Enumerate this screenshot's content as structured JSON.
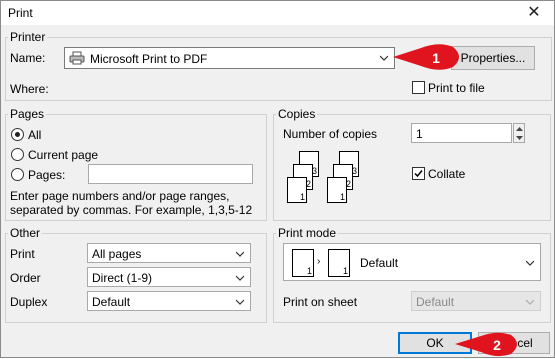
{
  "window": {
    "title": "Print"
  },
  "printer": {
    "group_label": "Printer",
    "name_label": "Name:",
    "name_value": "Microsoft Print to PDF",
    "properties_button": "Properties...",
    "where_label": "Where:",
    "print_to_file_label": "Print to file",
    "print_to_file_checked": false
  },
  "pages": {
    "group_label": "Pages",
    "all_label": "All",
    "current_label": "Current page",
    "pages_label": "Pages:",
    "pages_value": "",
    "selected": "All",
    "hint": [
      "Enter page numbers and/or page ranges,",
      "separated by commas. For example, 1,3,5-12"
    ]
  },
  "copies": {
    "group_label": "Copies",
    "count_label": "Number of copies",
    "count_value": "1",
    "collate_label": "Collate",
    "collate_checked": true,
    "stack_numbers": [
      "3",
      "2",
      "1",
      "3",
      "2",
      "1"
    ]
  },
  "other": {
    "group_label": "Other",
    "print_label": "Print",
    "print_value": "All pages",
    "order_label": "Order",
    "order_value": "Direct (1-9)",
    "duplex_label": "Duplex",
    "duplex_value": "Default"
  },
  "print_mode": {
    "group_label": "Print mode",
    "mode_value": "Default",
    "preview_numbers": [
      "1",
      "1"
    ],
    "sheet_label": "Print on sheet",
    "sheet_value": "Default"
  },
  "buttons": {
    "ok": "OK",
    "cancel": "Cancel"
  },
  "callouts": [
    {
      "number": "1"
    },
    {
      "number": "2"
    }
  ],
  "colors": {
    "callout": "#e0141e",
    "accent": "#0078d7"
  }
}
